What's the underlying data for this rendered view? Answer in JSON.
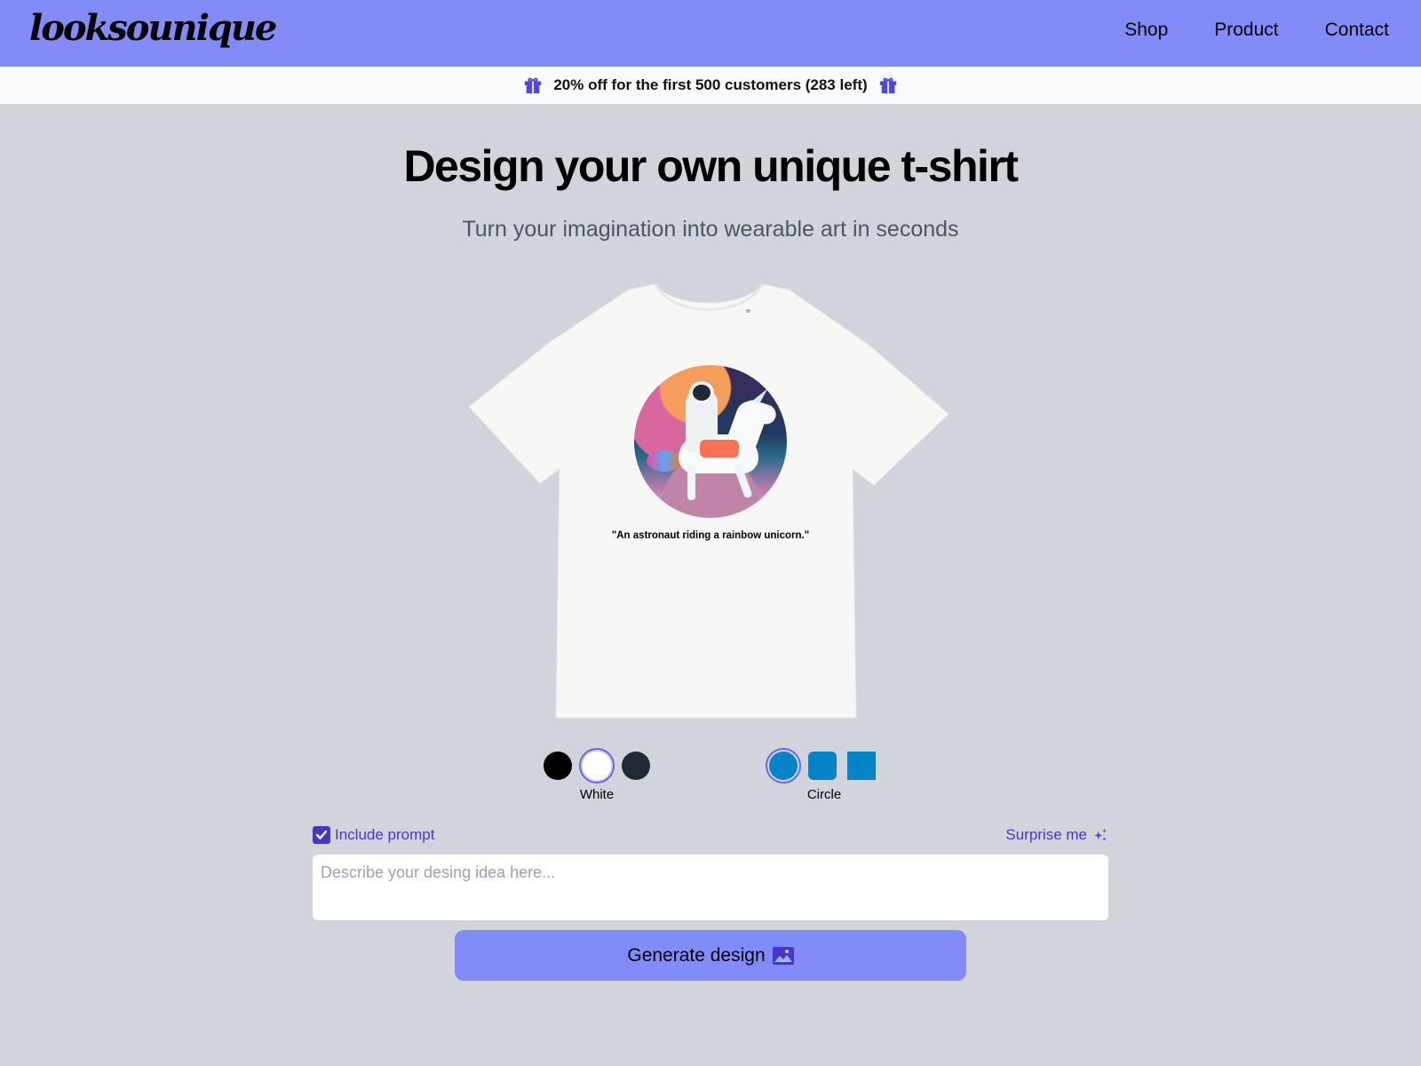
{
  "brand": {
    "logo": "looksounique",
    "accent_color": "#818cf8",
    "primary_color": "#4338ca"
  },
  "nav": {
    "items": [
      {
        "label": "Shop"
      },
      {
        "label": "Product"
      },
      {
        "label": "Contact"
      }
    ]
  },
  "promo": {
    "text": "20% off for the first 500 customers (283 left)",
    "icon": "gift-icon"
  },
  "hero": {
    "title": "Design your own unique t-shirt",
    "subtitle": "Turn your imagination into wearable art in seconds"
  },
  "preview": {
    "shirt_color": "White",
    "design_alt": "astronaut riding a rainbow unicorn illustration",
    "caption": "\"An astronaut riding a rainbow unicorn.\""
  },
  "shirt_colors": {
    "selected_label": "White",
    "options": [
      {
        "name": "Black",
        "hex": "#000000",
        "selected": false
      },
      {
        "name": "White",
        "hex": "#ffffff",
        "selected": true
      },
      {
        "name": "Navy",
        "hex": "#1f2937",
        "selected": false
      }
    ]
  },
  "shapes": {
    "selected_label": "Circle",
    "color": "#0284c7",
    "options": [
      {
        "name": "Circle",
        "selected": true
      },
      {
        "name": "Rounded",
        "selected": false
      },
      {
        "name": "Square",
        "selected": false
      }
    ]
  },
  "form": {
    "include_prompt_label": "Include prompt",
    "include_prompt_checked": true,
    "surprise_label": "Surprise me",
    "prompt_placeholder": "Describe your desing idea here...",
    "prompt_value": "",
    "generate_label": "Generate design"
  }
}
